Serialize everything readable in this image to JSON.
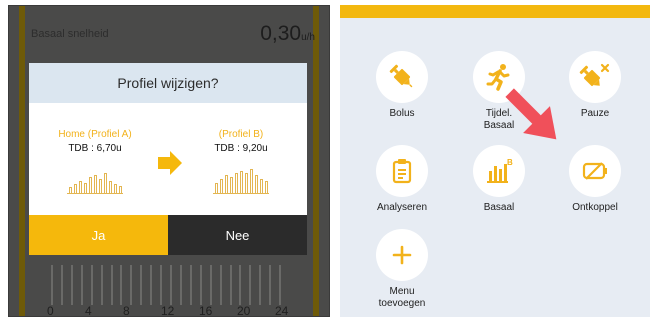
{
  "left_screen": {
    "background": {
      "title": "Basaal snelheid",
      "rate_value": "0,30",
      "rate_unit": "u/h",
      "axis_ticks": [
        "0",
        "4",
        "8",
        "12",
        "16",
        "20",
        "24"
      ]
    },
    "dialog": {
      "title": "Profiel wijzigen?",
      "from_profile": {
        "name": "Home (Profiel A)",
        "tdb": "TDB : 6,70u"
      },
      "to_profile": {
        "name": "(Profiel B)",
        "tdb": "TDB : 9,20u"
      },
      "yes_label": "Ja",
      "no_label": "Nee"
    }
  },
  "right_screen": {
    "menu_items": [
      {
        "label": "Bolus",
        "icon": "syringe-icon"
      },
      {
        "label": "Tijdel. Basaal",
        "icon": "running-person-icon"
      },
      {
        "label": "Pauze",
        "icon": "syringe-x-icon"
      },
      {
        "label": "Analyseren",
        "icon": "clipboard-icon"
      },
      {
        "label": "Basaal",
        "icon": "basal-chart-icon"
      },
      {
        "label": "Ontkoppel",
        "icon": "disconnect-icon"
      },
      {
        "label": "Menu toevoegen",
        "icon": "plus-icon"
      }
    ]
  },
  "colors": {
    "accent_yellow": "#f5b80c",
    "dark_button": "#2b2b2b",
    "dialog_header": "#dbe6f0",
    "menu_background": "#e7ecf3",
    "highlight_arrow": "#f0505a"
  }
}
